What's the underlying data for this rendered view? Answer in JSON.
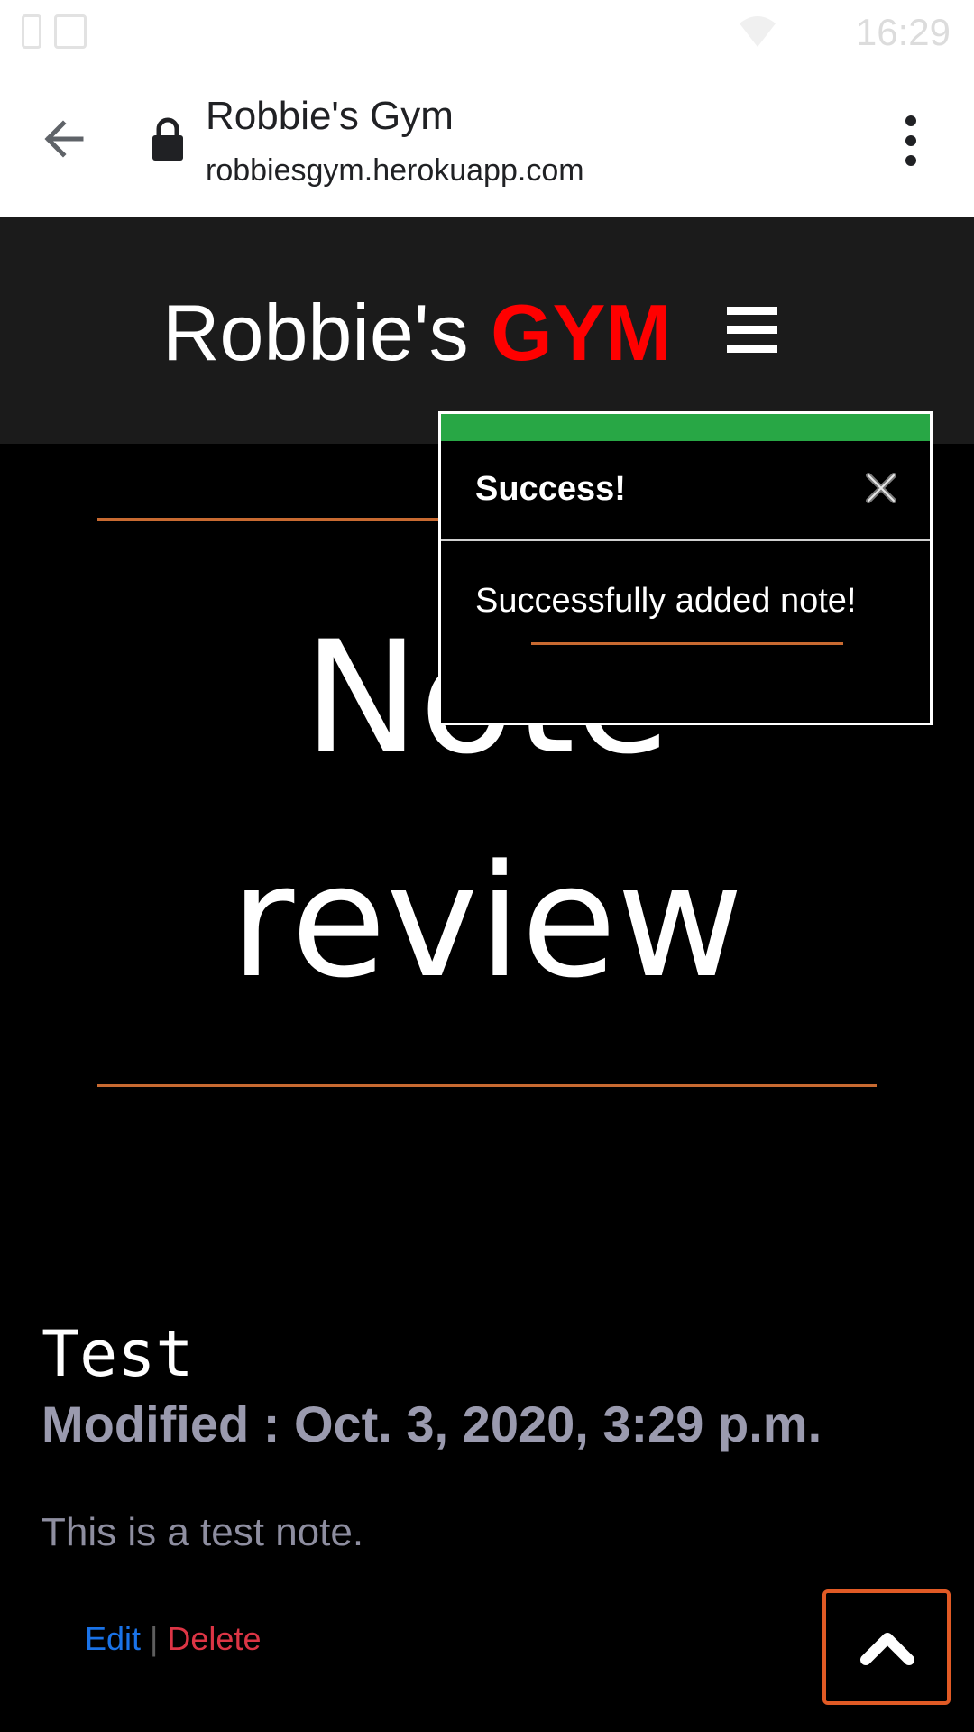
{
  "status_bar": {
    "time": "16:29"
  },
  "browser": {
    "page_title": "Robbie's Gym",
    "url": "robbiesgym.herokuapp.com"
  },
  "site": {
    "brand_prefix": "Robbie's",
    "brand_accent": "GYM",
    "accent_color": "#ff0000"
  },
  "page": {
    "heading_line1": "Note",
    "heading_line2": "review"
  },
  "toast": {
    "title": "Success!",
    "message": "Successfully added note!",
    "status_color": "#28a745"
  },
  "note": {
    "title": "Test",
    "modified": "Modified : Oct. 3, 2020, 3:29 p.m.",
    "body": "This is a test note.",
    "edit_label": "Edit",
    "separator": "|",
    "delete_label": "Delete"
  },
  "icons": {
    "back": "back-arrow-icon",
    "lock": "lock-icon",
    "menu": "more-vert-icon",
    "hamburger": "hamburger-menu-icon",
    "close": "close-icon",
    "scroll_top": "chevron-up-icon"
  }
}
